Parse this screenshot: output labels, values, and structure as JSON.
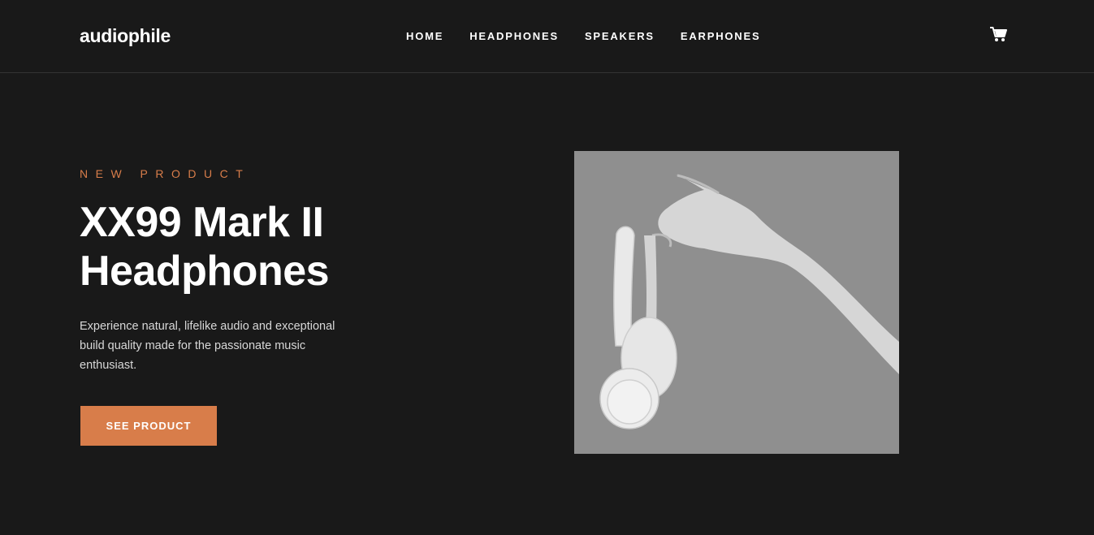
{
  "brand": {
    "logo_text": "audiophile"
  },
  "nav": {
    "items": [
      {
        "label": "HOME"
      },
      {
        "label": "HEADPHONES"
      },
      {
        "label": "SPEAKERS"
      },
      {
        "label": "EARPHONES"
      }
    ]
  },
  "cart": {
    "icon": "cart-icon"
  },
  "hero": {
    "eyebrow": "NEW PRODUCT",
    "title_line1": "XX99 Mark II",
    "title_line2": "Headphones",
    "description": "Experience natural, lifelike audio and exceptional build quality made for the passionate music enthusiast.",
    "cta_label": "SEE PRODUCT",
    "image_alt": "hand-holding-headphones"
  },
  "colors": {
    "background": "#191919",
    "accent": "#d87d4a",
    "text": "#ffffff",
    "muted_text": "#d8d8d8",
    "divider": "#333333"
  }
}
